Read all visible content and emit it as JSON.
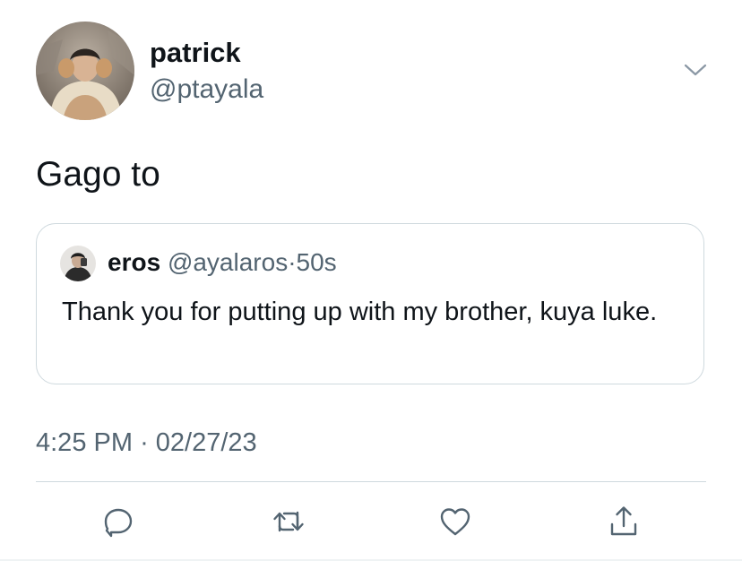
{
  "author": {
    "display_name": "patrick",
    "handle": "@ptayala",
    "avatar_icon": "profile-photo"
  },
  "tweet": {
    "text": "Gago to",
    "time": "4:25 PM",
    "separator": "·",
    "date": "02/27/23"
  },
  "quote": {
    "display_name": "eros",
    "handle": "@ayalaros",
    "separator": "·",
    "time": "50s",
    "text": "Thank you for putting up with my brother, kuya luke."
  },
  "actions": {
    "icons": [
      "reply-icon",
      "retweet-icon",
      "like-icon",
      "share-icon"
    ]
  },
  "colors": {
    "text_primary": "#0f1419",
    "text_secondary": "#536471",
    "border": "#cfd9de",
    "icon": "#536471"
  }
}
